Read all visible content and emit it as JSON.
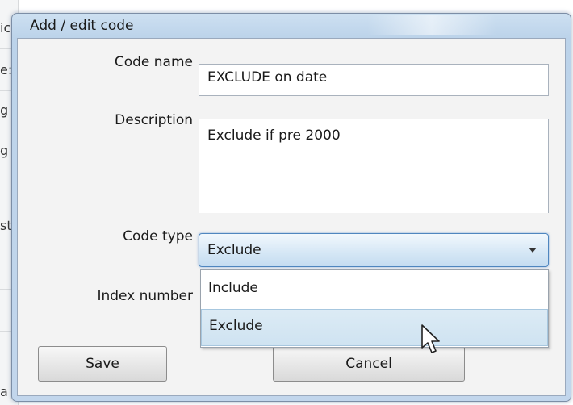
{
  "window": {
    "title": "Add / edit code"
  },
  "background": {
    "edge_chars": [
      "ic",
      "e:",
      "g",
      "g",
      "st",
      "a"
    ]
  },
  "form": {
    "code_name": {
      "label": "Code name",
      "value": "EXCLUDE on date"
    },
    "description": {
      "label": "Description",
      "value": "Exclude if pre 2000"
    },
    "code_type": {
      "label": "Code type",
      "selected": "Exclude",
      "options": [
        "Include",
        "Exclude"
      ],
      "highlighted_option": "Exclude"
    },
    "index_number": {
      "label": "Index number"
    }
  },
  "buttons": {
    "save": "Save",
    "cancel": "Cancel"
  },
  "colors": {
    "title_bar": "#c3d8ee",
    "combo_border": "#4f86bf",
    "option_highlight": "#d3e6f3"
  }
}
